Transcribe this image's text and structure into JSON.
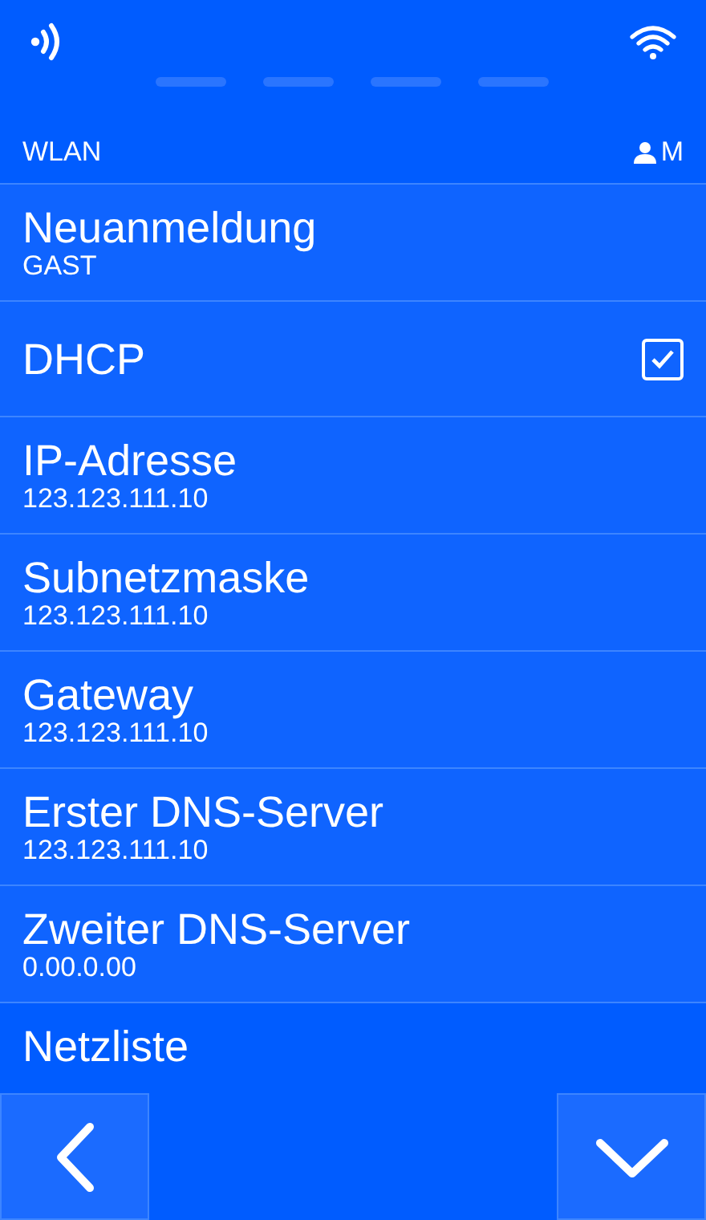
{
  "header": {
    "title": "WLAN",
    "user": "M"
  },
  "rows": [
    {
      "kind": "value",
      "label": "Neuanmeldung",
      "value": "GAST"
    },
    {
      "kind": "checkbox",
      "label": "DHCP",
      "checked": true
    },
    {
      "kind": "value",
      "label": "IP-Adresse",
      "value": "123.123.111.10"
    },
    {
      "kind": "value",
      "label": "Subnetzmaske",
      "value": "123.123.111.10"
    },
    {
      "kind": "value",
      "label": "Gateway",
      "value": "123.123.111.10"
    },
    {
      "kind": "value",
      "label": "Erster DNS-Server",
      "value": "123.123.111.10"
    },
    {
      "kind": "value",
      "label": "Zweiter DNS-Server",
      "value": "0.00.0.00"
    },
    {
      "kind": "link",
      "label": "Netzliste"
    }
  ]
}
